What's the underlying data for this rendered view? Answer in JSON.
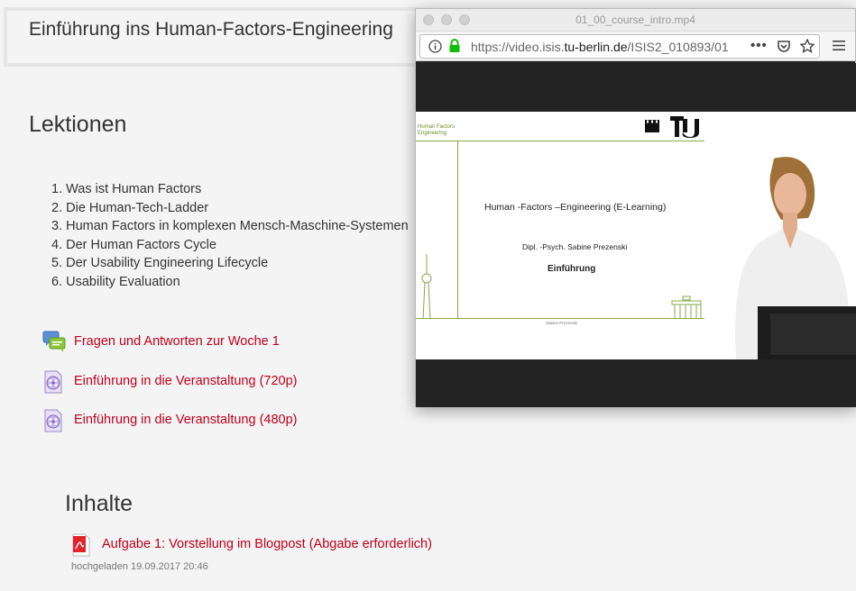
{
  "course": {
    "title": "Einführung ins Human-Factors-Engineering"
  },
  "lessons": {
    "heading": "Lektionen",
    "items": [
      "1. Was ist Human Factors",
      "2. Die Human-Tech-Ladder",
      "3. Human Factors in komplexen Mensch-Maschine-Systemen",
      "4. Der Human Factors Cycle",
      "5. Der Usability Engineering Lifecycle",
      "6. Usability Evaluation"
    ]
  },
  "activities": [
    {
      "label": "Fragen und Antworten zur Woche 1",
      "icon": "forum-icon"
    },
    {
      "label": "Einführung in die Veranstaltung (720p)",
      "icon": "video-file-icon"
    },
    {
      "label": "Einführung in die Veranstaltung (480p)",
      "icon": "video-file-icon"
    }
  ],
  "contents": {
    "heading": "Inhalte",
    "item": {
      "label": "Aufgabe 1: Vorstellung im Blogpost (Abgabe erforderlich)",
      "icon": "pdf-icon"
    },
    "meta": "hochgeladen 19.09.2017 20:46"
  },
  "popup": {
    "window_title": "01_00_course_intro.mp4",
    "url_prefix": "https://video.isis.",
    "url_domain": "tu-berlin.de",
    "url_suffix": "/ISIS2_010893/01",
    "icons": [
      "info-icon",
      "lock-icon",
      "more-icon",
      "pocket-icon",
      "bookmark-star-icon",
      "hamburger-menu-icon"
    ],
    "slide": {
      "logo_line1": "Human Factors",
      "logo_line2": "Engineering",
      "title": "Human -Factors –Engineering (E-Learning)",
      "author": "Dipl. -Psych. Sabine Prezenski",
      "subtitle": "Einführung",
      "footer": "Sabine Prezenski"
    }
  },
  "colors": {
    "link": "#c0001e",
    "slide_green": "#8aa84a",
    "page_bg": "#f4f4f4"
  }
}
